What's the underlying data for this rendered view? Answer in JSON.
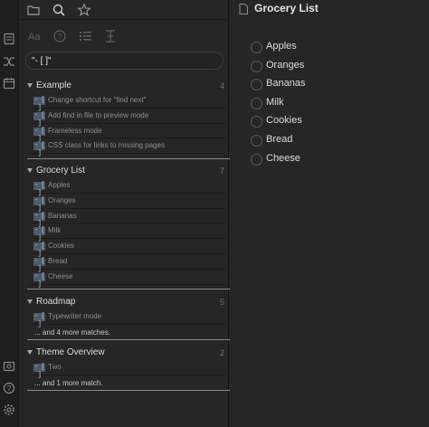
{
  "ribbon": {
    "icons": [
      "file-explorer-icon",
      "shuffle-icon",
      "calendar-icon",
      "vault-icon",
      "help-icon",
      "settings-icon"
    ]
  },
  "sidebar": {
    "tabs": [
      "folder-icon",
      "search-icon",
      "star-icon"
    ],
    "search_options": [
      "match-case-icon",
      "explain-query-icon",
      "collapse-results-icon",
      "show-more-context-icon"
    ],
    "search_query": "\"- [ ]\"",
    "groups": [
      {
        "title": "Example",
        "count": "4",
        "matches": [
          "Change shortcut for \"find next\"",
          "Add find in file to preview mode",
          "Frameless mode",
          "CSS class for links to missing pages"
        ],
        "more": ""
      },
      {
        "title": "Grocery List",
        "count": "7",
        "matches": [
          "Apples",
          "Oranges",
          "Bananas",
          "Milk",
          "Cookies",
          "Bread",
          "Cheese"
        ],
        "more": ""
      },
      {
        "title": "Roadmap",
        "count": "5",
        "matches": [
          "Typewriter mode"
        ],
        "more": "... and 4 more matches."
      },
      {
        "title": "Theme Overview",
        "count": "2",
        "matches": [
          "Two"
        ],
        "more": "... and 1 more match."
      }
    ],
    "checkbox_marker": "- [ ]"
  },
  "editor": {
    "title": "Grocery List",
    "todos": [
      "Apples",
      "Oranges",
      "Bananas",
      "Milk",
      "Cookies",
      "Bread",
      "Cheese"
    ]
  },
  "colors": {
    "background": "#262626",
    "ribbon": "#1e1e1e",
    "checkbox_tag": "#4b5a6d",
    "text": "#dcdcdc",
    "muted": "#8e8e8e"
  }
}
